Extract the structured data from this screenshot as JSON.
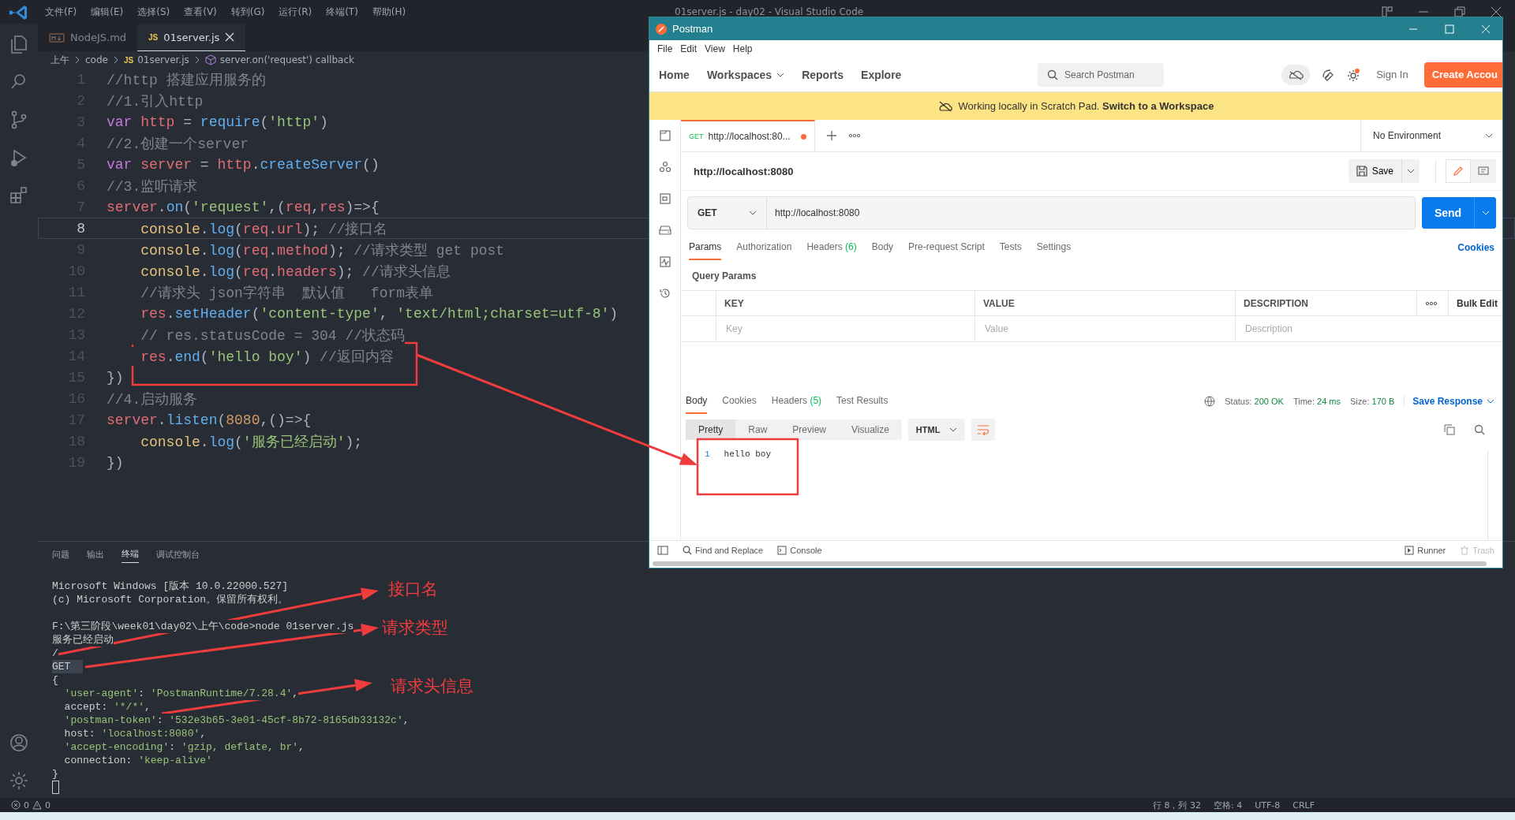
{
  "vscode": {
    "menu": [
      "文件(F)",
      "编辑(E)",
      "选择(S)",
      "查看(V)",
      "转到(G)",
      "运行(R)",
      "终端(T)",
      "帮助(H)"
    ],
    "window_title": "01server.js - day02 - Visual Studio Code",
    "tabs": [
      {
        "label": "NodeJS.md",
        "selected": false
      },
      {
        "label": "01server.js",
        "file_badge": "JS",
        "selected": true
      }
    ],
    "breadcrumbs": [
      {
        "text": "上午"
      },
      {
        "text": "code"
      },
      {
        "text": "01server.js",
        "file_badge": "JS"
      },
      {
        "text": "server.on('request') callback"
      }
    ],
    "code_lines": [
      {
        "number": "1",
        "current": false,
        "tokens": [
          {
            "kind": "comment",
            "text": "//http 搭建应用服务的"
          }
        ]
      },
      {
        "number": "2",
        "current": false,
        "tokens": [
          {
            "kind": "comment",
            "text": "//1.引入http"
          }
        ]
      },
      {
        "number": "3",
        "current": false,
        "tokens": [
          {
            "kind": "keyword",
            "text": "var "
          },
          {
            "kind": "variable",
            "text": "http"
          },
          {
            "kind": "plain",
            "text": " = "
          },
          {
            "kind": "function",
            "text": "require"
          },
          {
            "kind": "plain",
            "text": "("
          },
          {
            "kind": "string",
            "text": "'http'"
          },
          {
            "kind": "plain",
            "text": ")"
          }
        ]
      },
      {
        "number": "4",
        "current": false,
        "tokens": [
          {
            "kind": "comment",
            "text": "//2.创建一个server"
          }
        ]
      },
      {
        "number": "5",
        "current": false,
        "tokens": [
          {
            "kind": "keyword",
            "text": "var "
          },
          {
            "kind": "variable",
            "text": "server"
          },
          {
            "kind": "plain",
            "text": " = "
          },
          {
            "kind": "variable",
            "text": "http"
          },
          {
            "kind": "plain",
            "text": "."
          },
          {
            "kind": "function",
            "text": "createServer"
          },
          {
            "kind": "plain",
            "text": "()"
          }
        ]
      },
      {
        "number": "6",
        "current": false,
        "tokens": [
          {
            "kind": "comment",
            "text": "//3.监听请求"
          }
        ]
      },
      {
        "number": "7",
        "current": false,
        "tokens": [
          {
            "kind": "variable",
            "text": "server"
          },
          {
            "kind": "plain",
            "text": "."
          },
          {
            "kind": "function",
            "text": "on"
          },
          {
            "kind": "plain",
            "text": "("
          },
          {
            "kind": "string",
            "text": "'request'"
          },
          {
            "kind": "plain",
            "text": ",("
          },
          {
            "kind": "variable",
            "text": "req"
          },
          {
            "kind": "plain",
            "text": ","
          },
          {
            "kind": "variable",
            "text": "res"
          },
          {
            "kind": "plain",
            "text": ")=>{"
          }
        ]
      },
      {
        "number": "8",
        "current": true,
        "tokens": [
          {
            "kind": "object",
            "text": "    console"
          },
          {
            "kind": "plain",
            "text": "."
          },
          {
            "kind": "function",
            "text": "log"
          },
          {
            "kind": "plain",
            "text": "("
          },
          {
            "kind": "variable",
            "text": "req"
          },
          {
            "kind": "plain",
            "text": "."
          },
          {
            "kind": "variable",
            "text": "url"
          },
          {
            "kind": "plain",
            "text": "); "
          },
          {
            "kind": "comment",
            "text": "//接口名"
          }
        ]
      },
      {
        "number": "9",
        "current": false,
        "tokens": [
          {
            "kind": "object",
            "text": "    console"
          },
          {
            "kind": "plain",
            "text": "."
          },
          {
            "kind": "function",
            "text": "log"
          },
          {
            "kind": "plain",
            "text": "("
          },
          {
            "kind": "variable",
            "text": "req"
          },
          {
            "kind": "plain",
            "text": "."
          },
          {
            "kind": "variable",
            "text": "method"
          },
          {
            "kind": "plain",
            "text": "); "
          },
          {
            "kind": "comment",
            "text": "//请求类型 get post"
          }
        ]
      },
      {
        "number": "10",
        "current": false,
        "tokens": [
          {
            "kind": "object",
            "text": "    console"
          },
          {
            "kind": "plain",
            "text": "."
          },
          {
            "kind": "function",
            "text": "log"
          },
          {
            "kind": "plain",
            "text": "("
          },
          {
            "kind": "variable",
            "text": "req"
          },
          {
            "kind": "plain",
            "text": "."
          },
          {
            "kind": "variable",
            "text": "headers"
          },
          {
            "kind": "plain",
            "text": "); "
          },
          {
            "kind": "comment",
            "text": "//请求头信息"
          }
        ]
      },
      {
        "number": "11",
        "current": false,
        "tokens": [
          {
            "kind": "comment",
            "text": "    //请求头 json字符串  默认值   form表单"
          }
        ]
      },
      {
        "number": "12",
        "current": false,
        "tokens": [
          {
            "kind": "variable",
            "text": "    res"
          },
          {
            "kind": "plain",
            "text": "."
          },
          {
            "kind": "function",
            "text": "setHeader"
          },
          {
            "kind": "plain",
            "text": "("
          },
          {
            "kind": "string",
            "text": "'content-type'"
          },
          {
            "kind": "plain",
            "text": ", "
          },
          {
            "kind": "string",
            "text": "'text/html;charset=utf-8'"
          },
          {
            "kind": "plain",
            "text": ")"
          }
        ]
      },
      {
        "number": "13",
        "current": false,
        "tokens": [
          {
            "kind": "comment",
            "text": "    // res.statusCode = 304 //状态码"
          }
        ]
      },
      {
        "number": "14",
        "current": false,
        "tokens": [
          {
            "kind": "variable",
            "text": "    res"
          },
          {
            "kind": "plain",
            "text": "."
          },
          {
            "kind": "function",
            "text": "end"
          },
          {
            "kind": "plain",
            "text": "("
          },
          {
            "kind": "string",
            "text": "'hello boy'"
          },
          {
            "kind": "plain",
            "text": ") "
          },
          {
            "kind": "comment",
            "text": "//返回内容"
          }
        ]
      },
      {
        "number": "15",
        "current": false,
        "tokens": [
          {
            "kind": "plain",
            "text": "})"
          }
        ]
      },
      {
        "number": "16",
        "current": false,
        "tokens": [
          {
            "kind": "comment",
            "text": "//4.启动服务"
          }
        ]
      },
      {
        "number": "17",
        "current": false,
        "tokens": [
          {
            "kind": "variable",
            "text": "server"
          },
          {
            "kind": "plain",
            "text": "."
          },
          {
            "kind": "function",
            "text": "listen"
          },
          {
            "kind": "plain",
            "text": "("
          },
          {
            "kind": "number",
            "text": "8080"
          },
          {
            "kind": "plain",
            "text": ",()=>{"
          }
        ]
      },
      {
        "number": "18",
        "current": false,
        "tokens": [
          {
            "kind": "object",
            "text": "    console"
          },
          {
            "kind": "plain",
            "text": "."
          },
          {
            "kind": "function",
            "text": "log"
          },
          {
            "kind": "plain",
            "text": "("
          },
          {
            "kind": "string",
            "text": "'服务已经启动'"
          },
          {
            "kind": "plain",
            "text": ");"
          }
        ]
      },
      {
        "number": "19",
        "current": false,
        "tokens": [
          {
            "kind": "plain",
            "text": "})"
          }
        ]
      }
    ],
    "panel_tabs": [
      {
        "label": "问题",
        "selected": false
      },
      {
        "label": "输出",
        "selected": false
      },
      {
        "label": "终端",
        "selected": true
      },
      {
        "label": "调试控制台",
        "selected": false
      }
    ],
    "terminal_blocks": [
      {
        "lines": [
          {
            "highlighted": false,
            "tokens": [
              {
                "kind": "plain",
                "text": "Microsoft Windows [版本 10.0.22000.527]"
              }
            ]
          },
          {
            "highlighted": false,
            "tokens": [
              {
                "kind": "plain",
                "text": "(c) Microsoft Corporation。保留所有权利。"
              }
            ]
          }
        ]
      },
      {
        "lines": [
          {
            "highlighted": false,
            "tokens": [
              {
                "kind": "plain",
                "text": "F:\\第三阶段\\week01\\day02\\上午\\code>node 01server.js"
              }
            ]
          },
          {
            "highlighted": false,
            "tokens": [
              {
                "kind": "plain",
                "text": "服务已经启动"
              }
            ]
          },
          {
            "highlighted": false,
            "tokens": [
              {
                "kind": "plain",
                "text": "/"
              }
            ]
          },
          {
            "highlighted": true,
            "tokens": [
              {
                "kind": "plain",
                "text": "GET"
              }
            ]
          },
          {
            "highlighted": false,
            "tokens": [
              {
                "kind": "plain",
                "text": "{"
              }
            ]
          },
          {
            "highlighted": false,
            "tokens": [
              {
                "kind": "string",
                "text": "  'user-agent'"
              },
              {
                "kind": "plain",
                "text": ": "
              },
              {
                "kind": "string",
                "text": "'PostmanRuntime/7.28.4'"
              },
              {
                "kind": "plain",
                "text": ","
              }
            ]
          },
          {
            "highlighted": false,
            "tokens": [
              {
                "kind": "plain",
                "text": "  accept: "
              },
              {
                "kind": "string",
                "text": "'*/*'"
              },
              {
                "kind": "plain",
                "text": ","
              }
            ]
          },
          {
            "highlighted": false,
            "tokens": [
              {
                "kind": "string",
                "text": "  'postman-token'"
              },
              {
                "kind": "plain",
                "text": ": "
              },
              {
                "kind": "string",
                "text": "'532e3b65-3e01-45cf-8b72-8165db33132c'"
              },
              {
                "kind": "plain",
                "text": ","
              }
            ]
          },
          {
            "highlighted": false,
            "tokens": [
              {
                "kind": "plain",
                "text": "  host: "
              },
              {
                "kind": "string",
                "text": "'localhost:8080'"
              },
              {
                "kind": "plain",
                "text": ","
              }
            ]
          },
          {
            "highlighted": false,
            "tokens": [
              {
                "kind": "string",
                "text": "  'accept-encoding'"
              },
              {
                "kind": "plain",
                "text": ": "
              },
              {
                "kind": "string",
                "text": "'gzip, deflate, br'"
              },
              {
                "kind": "plain",
                "text": ","
              }
            ]
          },
          {
            "highlighted": false,
            "tokens": [
              {
                "kind": "plain",
                "text": "  connection: "
              },
              {
                "kind": "string",
                "text": "'keep-alive'"
              }
            ]
          },
          {
            "highlighted": false,
            "tokens": [
              {
                "kind": "plain",
                "text": "}"
              }
            ]
          }
        ]
      }
    ],
    "status_bar": {
      "errors": "0",
      "warnings": "0",
      "right": [
        "行 8，列 32",
        "空格: 4",
        "UTF-8",
        "CRLF"
      ]
    }
  },
  "postman": {
    "title": "Postman",
    "menu": [
      "File",
      "Edit",
      "View",
      "Help"
    ],
    "nav": [
      {
        "label": "Home",
        "has_menu": false
      },
      {
        "label": "Workspaces",
        "has_menu": true
      },
      {
        "label": "Reports",
        "has_menu": false
      },
      {
        "label": "Explore",
        "has_menu": false
      }
    ],
    "search": {
      "placeholder": "Search Postman"
    },
    "sign_in": "Sign In",
    "create_account": "Create Accou",
    "banner": "Working locally in Scratch Pad. **Switch to a Workspace**",
    "request_tab": {
      "method": "GET",
      "title": "http://localhost:80...",
      "unsaved": true,
      "selected": true
    },
    "environment": "No Environment",
    "request_name": "http://localhost:8080",
    "save": "Save",
    "method": "GET",
    "url": "http://localhost:8080",
    "send": "Send",
    "request_tabs": [
      {
        "label": "Params",
        "selected": true
      },
      {
        "label": "Authorization",
        "selected": false
      },
      {
        "label": "Headers",
        "count": "(6)",
        "selected": false
      },
      {
        "label": "Body",
        "selected": false
      },
      {
        "label": "Pre-request Script",
        "selected": false
      },
      {
        "label": "Tests",
        "selected": false
      },
      {
        "label": "Settings",
        "selected": false
      }
    ],
    "cookies": "Cookies",
    "query_params": {
      "title": "Query Params",
      "columns": [
        "KEY",
        "VALUE",
        "DESCRIPTION"
      ],
      "bulk_edit": "Bulk Edit",
      "placeholders": [
        "Key",
        "Value",
        "Description"
      ]
    },
    "response_tabs": [
      {
        "label": "Body",
        "selected": true
      },
      {
        "label": "Cookies",
        "selected": false
      },
      {
        "label": "Headers",
        "count": "(5)",
        "selected": false
      },
      {
        "label": "Test Results",
        "selected": false
      }
    ],
    "response_stats": [
      {
        "label": "Status:",
        "value": "200 OK"
      },
      {
        "label": "Time:",
        "value": "24 ms"
      },
      {
        "label": "Size:",
        "value": "170 B"
      }
    ],
    "save_response": "Save Response",
    "format_tabs": [
      {
        "label": "Pretty",
        "selected": true
      },
      {
        "label": "Raw",
        "selected": false
      },
      {
        "label": "Preview",
        "selected": false
      },
      {
        "label": "Visualize",
        "selected": false
      }
    ],
    "language": "HTML",
    "response_lines": [
      {
        "number": "1",
        "text": "hello boy"
      }
    ],
    "footer_left": [
      "Find and Replace",
      "Console"
    ],
    "footer_right": [
      {
        "label": "Runner",
        "disabled": false
      },
      {
        "label": "Trash",
        "disabled": true
      }
    ]
  },
  "annotations": [
    "接口名",
    "请求类型",
    "请求头信息"
  ]
}
